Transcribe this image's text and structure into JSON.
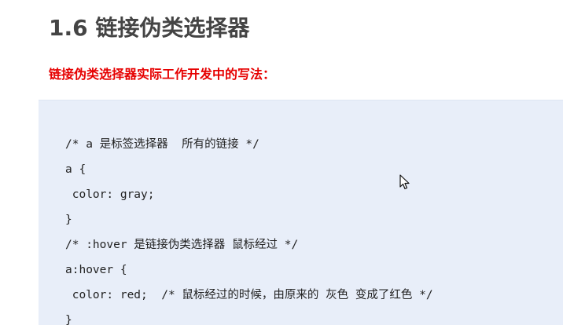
{
  "slide": {
    "title": "1.6 链接伪类选择器",
    "subtitle": "链接伪类选择器实际工作开发中的写法："
  },
  "code": {
    "lines": [
      "/* a 是标签选择器  所有的链接 */",
      "a {",
      " color: gray;",
      "}",
      "/* :hover 是链接伪类选择器 鼠标经过 */",
      "a:hover {",
      " color: red;  /* 鼠标经过的时候，由原来的 灰色 变成了红色 */",
      "}"
    ]
  },
  "colors": {
    "title": "#444444",
    "subtitle": "#e60000",
    "code_background": "#e8eef9",
    "code_text": "#222222"
  },
  "icons": {
    "cursor": "mouse-pointer-icon"
  }
}
